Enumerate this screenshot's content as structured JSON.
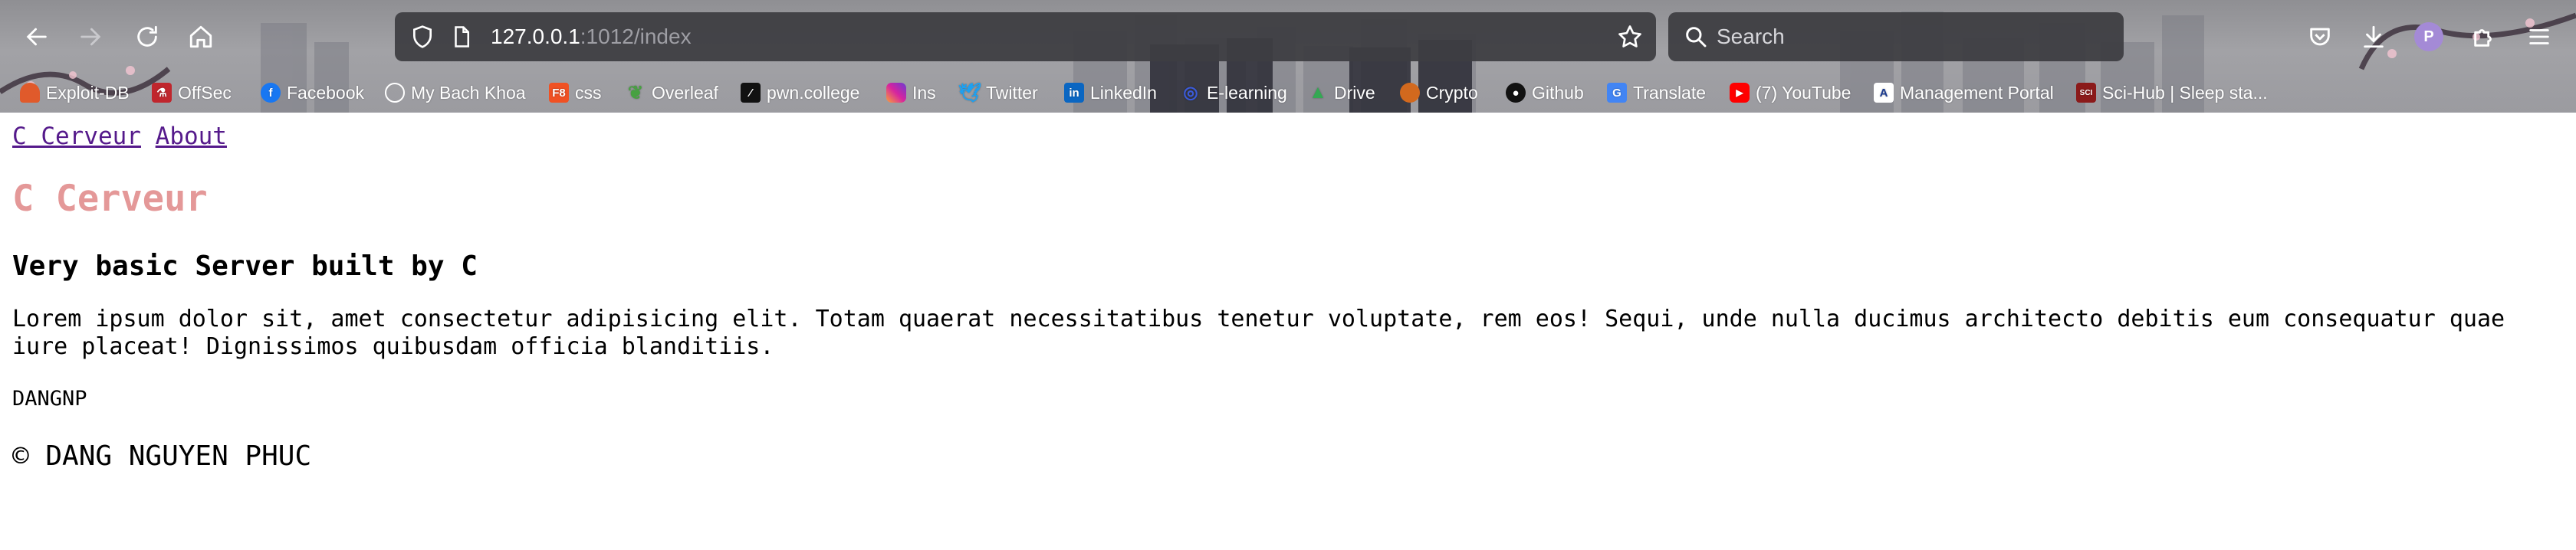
{
  "browser": {
    "url_host": "127.0.0.1",
    "url_path": ":1012/index",
    "search_placeholder": "Search",
    "profile_initial": "P",
    "bookmarks": [
      {
        "label": "Exploit-DB",
        "icon": "exploit-db-icon",
        "color": "#e05a2b"
      },
      {
        "label": "OffSec",
        "icon": "offsec-icon",
        "color": "#c0262d"
      },
      {
        "label": "Facebook",
        "icon": "facebook-icon",
        "color": "#1877f2"
      },
      {
        "label": "My Bach Khoa",
        "icon": "globe-icon",
        "color": "#ffffff"
      },
      {
        "label": "css",
        "icon": "f8-icon",
        "color": "#f05123"
      },
      {
        "label": "Overleaf",
        "icon": "overleaf-icon",
        "color": "#47a141"
      },
      {
        "label": "pwn.college",
        "icon": "pwn-college-icon",
        "color": "#111111"
      },
      {
        "label": "Ins",
        "icon": "instagram-icon",
        "color": "#d6249f"
      },
      {
        "label": "Twitter",
        "icon": "twitter-icon",
        "color": "#1da1f2"
      },
      {
        "label": "LinkedIn",
        "icon": "linkedin-icon",
        "color": "#0a66c2"
      },
      {
        "label": "E-learning",
        "icon": "e-learning-icon",
        "color": "#3b5bdb"
      },
      {
        "label": "Drive",
        "icon": "google-drive-icon",
        "color": "#34a853"
      },
      {
        "label": "Crypto",
        "icon": "crypto-icon",
        "color": "#d2691e"
      },
      {
        "label": "Github",
        "icon": "github-icon",
        "color": "#111111"
      },
      {
        "label": "Translate",
        "icon": "google-translate-icon",
        "color": "#4285f4"
      },
      {
        "label": "(7) YouTube",
        "icon": "youtube-icon",
        "color": "#ff0000"
      },
      {
        "label": "Management Portal",
        "icon": "management-portal-icon",
        "color": "#1a3a8f"
      },
      {
        "label": "Sci-Hub | Sleep sta...",
        "icon": "sci-hub-icon",
        "color": "#8b1a1a"
      }
    ]
  },
  "page": {
    "nav": {
      "home": "C Cerveur",
      "about": "About"
    },
    "title": "C Cerveur",
    "subtitle": "Very basic Server built by C",
    "body": "Lorem ipsum dolor sit, amet consectetur adipisicing elit. Totam quaerat necessitatibus tenetur voluptate, rem eos! Sequi, unde nulla ducimus architecto debitis eum consequatur quae iure placeat! Dignissimos quibusdam officia blanditiis.",
    "author": "DANGNP",
    "copyright": "© DANG NGUYEN PHUC"
  },
  "colors": {
    "title": "#e49898",
    "link_visited": "#551a8b"
  }
}
